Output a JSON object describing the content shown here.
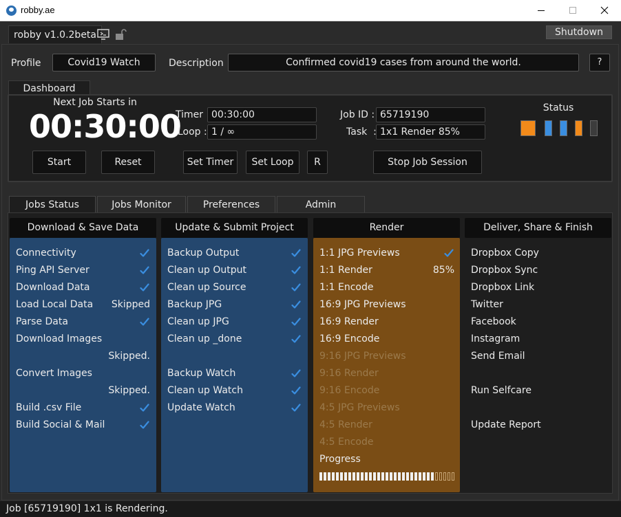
{
  "window": {
    "title": "robby.ae"
  },
  "header": {
    "version": "robby v1.0.2beta",
    "shutdown_label": "Shutdown"
  },
  "profile": {
    "label": "Profile",
    "value": "Covid19 Watch",
    "description_label": "Description",
    "description": "Confirmed covid19 cases from around the world.",
    "help_label": "?"
  },
  "dashboard": {
    "tab_label": "Dashboard",
    "next_job_label": "Next Job Starts in",
    "countdown": "00:30:00",
    "timer_label": "Timer :",
    "timer_value": "00:30:00",
    "loop_label": "Loop :",
    "loop_value": "1 / ∞",
    "job_id_label": "Job ID :",
    "job_id_value": "65719190",
    "task_label": "Task  :",
    "task_value": "1x1 Render 85%",
    "status_label": "Status",
    "status_colors": [
      "#f28a1a",
      "#3a8ee0",
      "#3a8ee0",
      "#f28a1a",
      "#3c3c3c"
    ],
    "buttons": {
      "start": "Start",
      "reset": "Reset",
      "set_timer": "Set Timer",
      "set_loop": "Set Loop",
      "r": "R",
      "stop": "Stop Job Session"
    }
  },
  "tabs": [
    {
      "label": "Jobs Status",
      "active": true
    },
    {
      "label": "Jobs Monitor",
      "active": false
    },
    {
      "label": "Preferences",
      "active": false
    },
    {
      "label": "Admin",
      "active": false
    }
  ],
  "columns": {
    "download": {
      "title": "Download & Save Data",
      "items": [
        {
          "label": "Connectivity",
          "value": "",
          "check": true
        },
        {
          "label": "Ping API Server",
          "value": "",
          "check": true
        },
        {
          "label": "Download Data",
          "value": "",
          "check": true
        },
        {
          "label": "Load Local Data",
          "value": "Skipped",
          "check": false
        },
        {
          "label": "Parse Data",
          "value": "",
          "check": true
        },
        {
          "label": "Download Images",
          "value": "",
          "check": false
        },
        {
          "label": "",
          "value": "Skipped.",
          "check": false
        },
        {
          "label": "Convert Images",
          "value": "",
          "check": false
        },
        {
          "label": "",
          "value": "Skipped.",
          "check": false
        },
        {
          "label": "Build .csv File",
          "value": "",
          "check": true
        },
        {
          "label": "Build Social & Mail",
          "value": "",
          "check": true
        }
      ]
    },
    "update": {
      "title": "Update & Submit Project",
      "items": [
        {
          "label": "Backup Output",
          "check": true
        },
        {
          "label": "Clean up Output",
          "check": true
        },
        {
          "label": "Clean up Source",
          "check": true
        },
        {
          "label": "Backup JPG",
          "check": true
        },
        {
          "label": "Clean up JPG",
          "check": true
        },
        {
          "label": "Clean up _done",
          "check": true
        },
        {
          "label": "",
          "check": false
        },
        {
          "label": "Backup Watch",
          "check": true
        },
        {
          "label": "Clean up Watch",
          "check": true
        },
        {
          "label": "Update Watch",
          "check": true
        }
      ]
    },
    "render": {
      "title": "Render",
      "items": [
        {
          "label": "1:1 JPG Previews",
          "value": "",
          "check": true,
          "dim": false
        },
        {
          "label": "1:1 Render",
          "value": "85%",
          "check": false,
          "dim": false
        },
        {
          "label": "1:1 Encode",
          "value": "",
          "check": false,
          "dim": false
        },
        {
          "label": "16:9 JPG Previews",
          "value": "",
          "check": false,
          "dim": false
        },
        {
          "label": "16:9 Render",
          "value": "",
          "check": false,
          "dim": false
        },
        {
          "label": "16:9 Encode",
          "value": "",
          "check": false,
          "dim": false
        },
        {
          "label": "9:16 JPG Previews",
          "value": "",
          "check": false,
          "dim": true
        },
        {
          "label": "9:16 Render",
          "value": "",
          "check": false,
          "dim": true
        },
        {
          "label": "9:16 Encode",
          "value": "",
          "check": false,
          "dim": true
        },
        {
          "label": "4:5 JPG Previews",
          "value": "",
          "check": false,
          "dim": true
        },
        {
          "label": "4:5 Render",
          "value": "",
          "check": false,
          "dim": true
        },
        {
          "label": "4:5 Encode",
          "value": "",
          "check": false,
          "dim": true
        },
        {
          "label": "Progress",
          "value": "",
          "check": false,
          "dim": false
        }
      ],
      "progress_fraction": 0.85
    },
    "deliver": {
      "title": "Deliver, Share & Finish",
      "items": [
        {
          "label": "Dropbox Copy"
        },
        {
          "label": "Dropbox Sync"
        },
        {
          "label": "Dropbox Link"
        },
        {
          "label": "Twitter"
        },
        {
          "label": "Facebook"
        },
        {
          "label": "Instagram"
        },
        {
          "label": "Send Email"
        },
        {
          "label": ""
        },
        {
          "label": "Run Selfcare"
        },
        {
          "label": ""
        },
        {
          "label": "Update Report"
        }
      ]
    }
  },
  "statusbar": {
    "text": "Job [65719190] 1x1 is Rendering."
  },
  "colors": {
    "check": "#3a8ee0",
    "blue_panel": "#24476e",
    "orange_panel": "#7a4d15"
  }
}
